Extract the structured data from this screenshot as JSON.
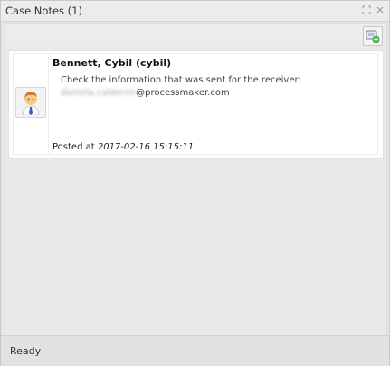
{
  "window": {
    "title": "Case Notes (1)",
    "icons": [
      "restore-icon",
      "close-icon"
    ]
  },
  "toolbar": {
    "add_note_icon": "add-note-icon"
  },
  "notes": [
    {
      "author": "Bennett, Cybil (cybil)",
      "text_prefix": "Check the information that was sent for the receiver:",
      "email_user": "daniela.calderon",
      "email_domain": "@processmaker.com",
      "posted_label": "Posted at",
      "posted_date": "2017-02-16 15:15:11",
      "avatar_icon": "user-avatar-icon"
    }
  ],
  "status": {
    "text": "Ready"
  }
}
